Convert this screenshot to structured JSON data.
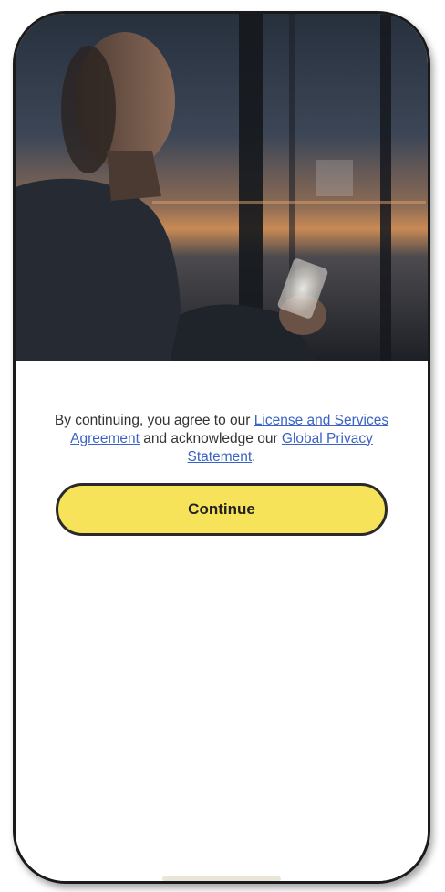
{
  "hero": {
    "image_alt": "man looking at phone by window at dusk"
  },
  "consent": {
    "prefix": "By continuing, you agree to our ",
    "license_link": "License and Services Agreement",
    "middle": " and acknowledge our ",
    "privacy_link": "Global Privacy Statement",
    "suffix": "."
  },
  "continue_button": {
    "label": "Continue"
  },
  "colors": {
    "accent_yellow": "#f6e35a",
    "link_blue": "#3b63c4",
    "text": "#333333"
  }
}
